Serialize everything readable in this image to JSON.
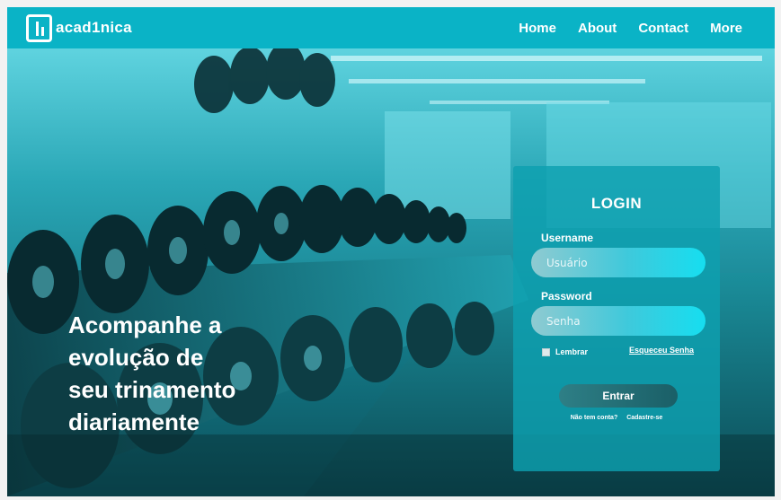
{
  "header": {
    "logo_text": "acad1nica",
    "nav": [
      "Home",
      "About",
      "Contact",
      "More"
    ]
  },
  "hero": {
    "tagline": [
      "Acompanhe a",
      "evolução de",
      "seu trinamento",
      "diariamente"
    ]
  },
  "login": {
    "title": "LOGIN",
    "username_label": "Username",
    "username_placeholder": "Usuário",
    "password_label": "Password",
    "password_placeholder": "Senha",
    "remember_label": "Lembrar",
    "forgot_link": "Esqueceu Senha",
    "submit_label": "Entrar",
    "no_account_text": "Não tem conta?",
    "signup_link": "Cadastre-se"
  },
  "colors": {
    "brand": "#0ab3c6",
    "card": "#0ea0b0",
    "button": "#1a5f67"
  },
  "icons": [
    "logo-mark-icon",
    "checkbox-icon"
  ]
}
